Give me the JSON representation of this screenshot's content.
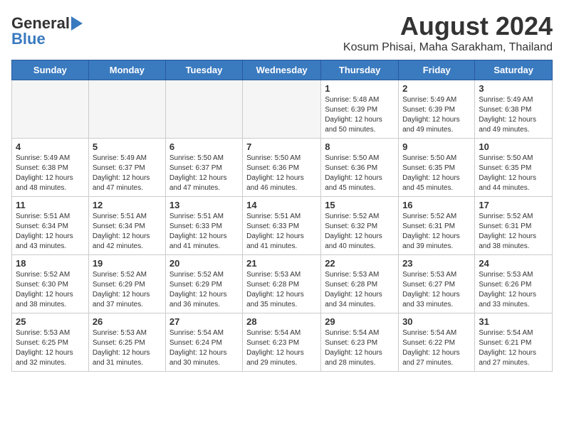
{
  "logo": {
    "part1": "General",
    "part2": "Blue"
  },
  "title": "August 2024",
  "subtitle": "Kosum Phisai, Maha Sarakham, Thailand",
  "days_of_week": [
    "Sunday",
    "Monday",
    "Tuesday",
    "Wednesday",
    "Thursday",
    "Friday",
    "Saturday"
  ],
  "weeks": [
    [
      {
        "day": "",
        "info": ""
      },
      {
        "day": "",
        "info": ""
      },
      {
        "day": "",
        "info": ""
      },
      {
        "day": "",
        "info": ""
      },
      {
        "day": "1",
        "info": "Sunrise: 5:48 AM\nSunset: 6:39 PM\nDaylight: 12 hours\nand 50 minutes."
      },
      {
        "day": "2",
        "info": "Sunrise: 5:49 AM\nSunset: 6:39 PM\nDaylight: 12 hours\nand 49 minutes."
      },
      {
        "day": "3",
        "info": "Sunrise: 5:49 AM\nSunset: 6:38 PM\nDaylight: 12 hours\nand 49 minutes."
      }
    ],
    [
      {
        "day": "4",
        "info": "Sunrise: 5:49 AM\nSunset: 6:38 PM\nDaylight: 12 hours\nand 48 minutes."
      },
      {
        "day": "5",
        "info": "Sunrise: 5:49 AM\nSunset: 6:37 PM\nDaylight: 12 hours\nand 47 minutes."
      },
      {
        "day": "6",
        "info": "Sunrise: 5:50 AM\nSunset: 6:37 PM\nDaylight: 12 hours\nand 47 minutes."
      },
      {
        "day": "7",
        "info": "Sunrise: 5:50 AM\nSunset: 6:36 PM\nDaylight: 12 hours\nand 46 minutes."
      },
      {
        "day": "8",
        "info": "Sunrise: 5:50 AM\nSunset: 6:36 PM\nDaylight: 12 hours\nand 45 minutes."
      },
      {
        "day": "9",
        "info": "Sunrise: 5:50 AM\nSunset: 6:35 PM\nDaylight: 12 hours\nand 45 minutes."
      },
      {
        "day": "10",
        "info": "Sunrise: 5:50 AM\nSunset: 6:35 PM\nDaylight: 12 hours\nand 44 minutes."
      }
    ],
    [
      {
        "day": "11",
        "info": "Sunrise: 5:51 AM\nSunset: 6:34 PM\nDaylight: 12 hours\nand 43 minutes."
      },
      {
        "day": "12",
        "info": "Sunrise: 5:51 AM\nSunset: 6:34 PM\nDaylight: 12 hours\nand 42 minutes."
      },
      {
        "day": "13",
        "info": "Sunrise: 5:51 AM\nSunset: 6:33 PM\nDaylight: 12 hours\nand 41 minutes."
      },
      {
        "day": "14",
        "info": "Sunrise: 5:51 AM\nSunset: 6:33 PM\nDaylight: 12 hours\nand 41 minutes."
      },
      {
        "day": "15",
        "info": "Sunrise: 5:52 AM\nSunset: 6:32 PM\nDaylight: 12 hours\nand 40 minutes."
      },
      {
        "day": "16",
        "info": "Sunrise: 5:52 AM\nSunset: 6:31 PM\nDaylight: 12 hours\nand 39 minutes."
      },
      {
        "day": "17",
        "info": "Sunrise: 5:52 AM\nSunset: 6:31 PM\nDaylight: 12 hours\nand 38 minutes."
      }
    ],
    [
      {
        "day": "18",
        "info": "Sunrise: 5:52 AM\nSunset: 6:30 PM\nDaylight: 12 hours\nand 38 minutes."
      },
      {
        "day": "19",
        "info": "Sunrise: 5:52 AM\nSunset: 6:29 PM\nDaylight: 12 hours\nand 37 minutes."
      },
      {
        "day": "20",
        "info": "Sunrise: 5:52 AM\nSunset: 6:29 PM\nDaylight: 12 hours\nand 36 minutes."
      },
      {
        "day": "21",
        "info": "Sunrise: 5:53 AM\nSunset: 6:28 PM\nDaylight: 12 hours\nand 35 minutes."
      },
      {
        "day": "22",
        "info": "Sunrise: 5:53 AM\nSunset: 6:28 PM\nDaylight: 12 hours\nand 34 minutes."
      },
      {
        "day": "23",
        "info": "Sunrise: 5:53 AM\nSunset: 6:27 PM\nDaylight: 12 hours\nand 33 minutes."
      },
      {
        "day": "24",
        "info": "Sunrise: 5:53 AM\nSunset: 6:26 PM\nDaylight: 12 hours\nand 33 minutes."
      }
    ],
    [
      {
        "day": "25",
        "info": "Sunrise: 5:53 AM\nSunset: 6:25 PM\nDaylight: 12 hours\nand 32 minutes."
      },
      {
        "day": "26",
        "info": "Sunrise: 5:53 AM\nSunset: 6:25 PM\nDaylight: 12 hours\nand 31 minutes."
      },
      {
        "day": "27",
        "info": "Sunrise: 5:54 AM\nSunset: 6:24 PM\nDaylight: 12 hours\nand 30 minutes."
      },
      {
        "day": "28",
        "info": "Sunrise: 5:54 AM\nSunset: 6:23 PM\nDaylight: 12 hours\nand 29 minutes."
      },
      {
        "day": "29",
        "info": "Sunrise: 5:54 AM\nSunset: 6:23 PM\nDaylight: 12 hours\nand 28 minutes."
      },
      {
        "day": "30",
        "info": "Sunrise: 5:54 AM\nSunset: 6:22 PM\nDaylight: 12 hours\nand 27 minutes."
      },
      {
        "day": "31",
        "info": "Sunrise: 5:54 AM\nSunset: 6:21 PM\nDaylight: 12 hours\nand 27 minutes."
      }
    ]
  ]
}
